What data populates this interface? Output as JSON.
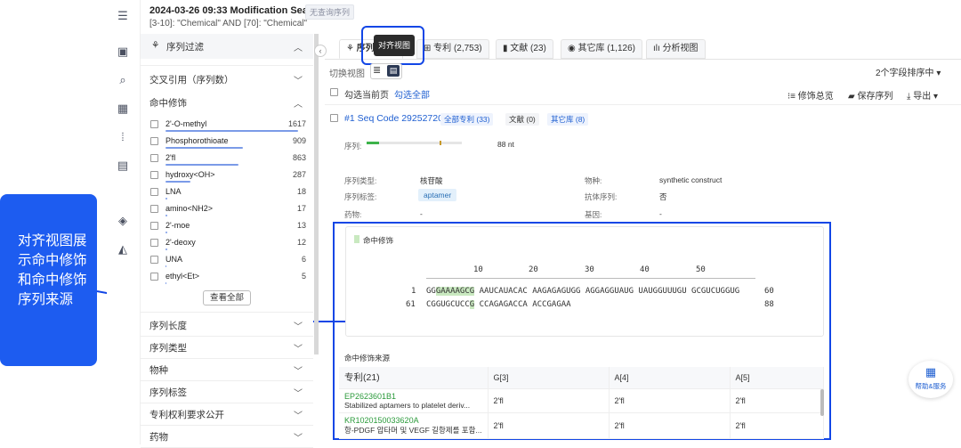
{
  "header": {
    "title": "2024-03-26 09:33 Modification Search",
    "tag": "无查询序列",
    "query": "[3-10]: \"Chemical\" AND [70]: \"Chemical\""
  },
  "rail": {
    "icons": [
      "menu-expand-icon",
      "bookmark-icon",
      "search-icon",
      "grid-icon",
      "barcode-icon",
      "chart-icon",
      "layers-icon",
      "upload-icon"
    ]
  },
  "filter": {
    "title": "序列过滤",
    "sections": {
      "cross_ref": "交叉引用（序列数）",
      "hit_mod": "命中修饰"
    },
    "items": [
      {
        "name": "2'-O-methyl",
        "count": "1617",
        "fill": 0.96
      },
      {
        "name": "Phosphorothioate",
        "count": "909",
        "fill": 0.56
      },
      {
        "name": "2'fl",
        "count": "863",
        "fill": 0.53
      },
      {
        "name": "hydroxy<OH>",
        "count": "287",
        "fill": 0.18
      },
      {
        "name": "LNA",
        "count": "18",
        "fill": 0.01
      },
      {
        "name": "amino<NH2>",
        "count": "17",
        "fill": 0.01
      },
      {
        "name": "2'-moe",
        "count": "13",
        "fill": 0.01
      },
      {
        "name": "2'-deoxy",
        "count": "12",
        "fill": 0.01
      },
      {
        "name": "UNA",
        "count": "6",
        "fill": 0.0
      },
      {
        "name": "ethyl<Et>",
        "count": "5",
        "fill": 0.0
      }
    ],
    "view_all": "查看全部",
    "more_sections": [
      "序列长度",
      "序列类型",
      "物种",
      "序列标签",
      "专利权利要求公开",
      "药物"
    ]
  },
  "tabs": [
    {
      "label": "序列",
      "icon": "dna-icon"
    },
    {
      "label": "专利 (2,753)",
      "icon": "patent-icon"
    },
    {
      "label": "文献 (23)",
      "icon": "doc-icon"
    },
    {
      "label": "其它库 (1,126)",
      "icon": "db-icon"
    },
    {
      "label": "分析视图",
      "icon": "chart-icon"
    }
  ],
  "tooltip": "对齐视图",
  "toolbar": {
    "switch_view": "切换视图",
    "sort": "2个字段排序中",
    "select_page": "勾选当前页",
    "select_all": "勾选全部",
    "mod_overview": "修饰总览",
    "save_seq": "保存序列",
    "export": "导出"
  },
  "record": {
    "title": "#1 Seq Code 29252720",
    "badges": [
      "全部专利 (33)",
      "文献 (0)",
      "其它库 (8)"
    ],
    "seq_label": "序列:",
    "length": "88 nt",
    "fields_left": [
      {
        "k": "序列类型:",
        "v": "核苷酸"
      },
      {
        "k": "序列标签:",
        "v": "aptamer"
      },
      {
        "k": "药物:",
        "v": "-"
      }
    ],
    "fields_right": [
      {
        "k": "物种:",
        "v": "synthetic construct"
      },
      {
        "k": "抗体序列:",
        "v": "否"
      },
      {
        "k": "基因:",
        "v": "-"
      }
    ]
  },
  "alignment": {
    "legend": "命中修饰",
    "ruler": [
      "10",
      "20",
      "30",
      "40",
      "50"
    ],
    "line1_start": "1",
    "line1_pre": "GG",
    "line1_hl": "GAAAAGCG",
    "line1_post": " AAUCAUACAC AAGAGAGUGG AGGAGGUAUG UAUGGUUUGU GCGUCUGGUG",
    "line1_end": "60",
    "line2_start": "61",
    "line2_pre": "CGGUGCUCC",
    "line2_hl": "G",
    "line2_post": " CCAGAGACCA ACCGAGAA",
    "line2_end": "88"
  },
  "source": {
    "title": "命中修饰来源",
    "headers": [
      "专利(21)",
      "G[3]",
      "A[4]",
      "A[5]"
    ],
    "rows": [
      {
        "id": "EP2623601B1",
        "title": "Stabilized aptamers to platelet deriv...",
        "c1": "2'fl",
        "c2": "2'fl",
        "c3": "2'fl"
      },
      {
        "id": "KR1020150033620A",
        "title": "항-PDGF 압타머 및 VEGF 길항제를 포함...",
        "c1": "2'fl",
        "c2": "2'fl",
        "c3": "2'fl"
      }
    ]
  },
  "callout": "对齐视图展示命中修饰和命中修饰序列来源",
  "help": "帮助&服务"
}
